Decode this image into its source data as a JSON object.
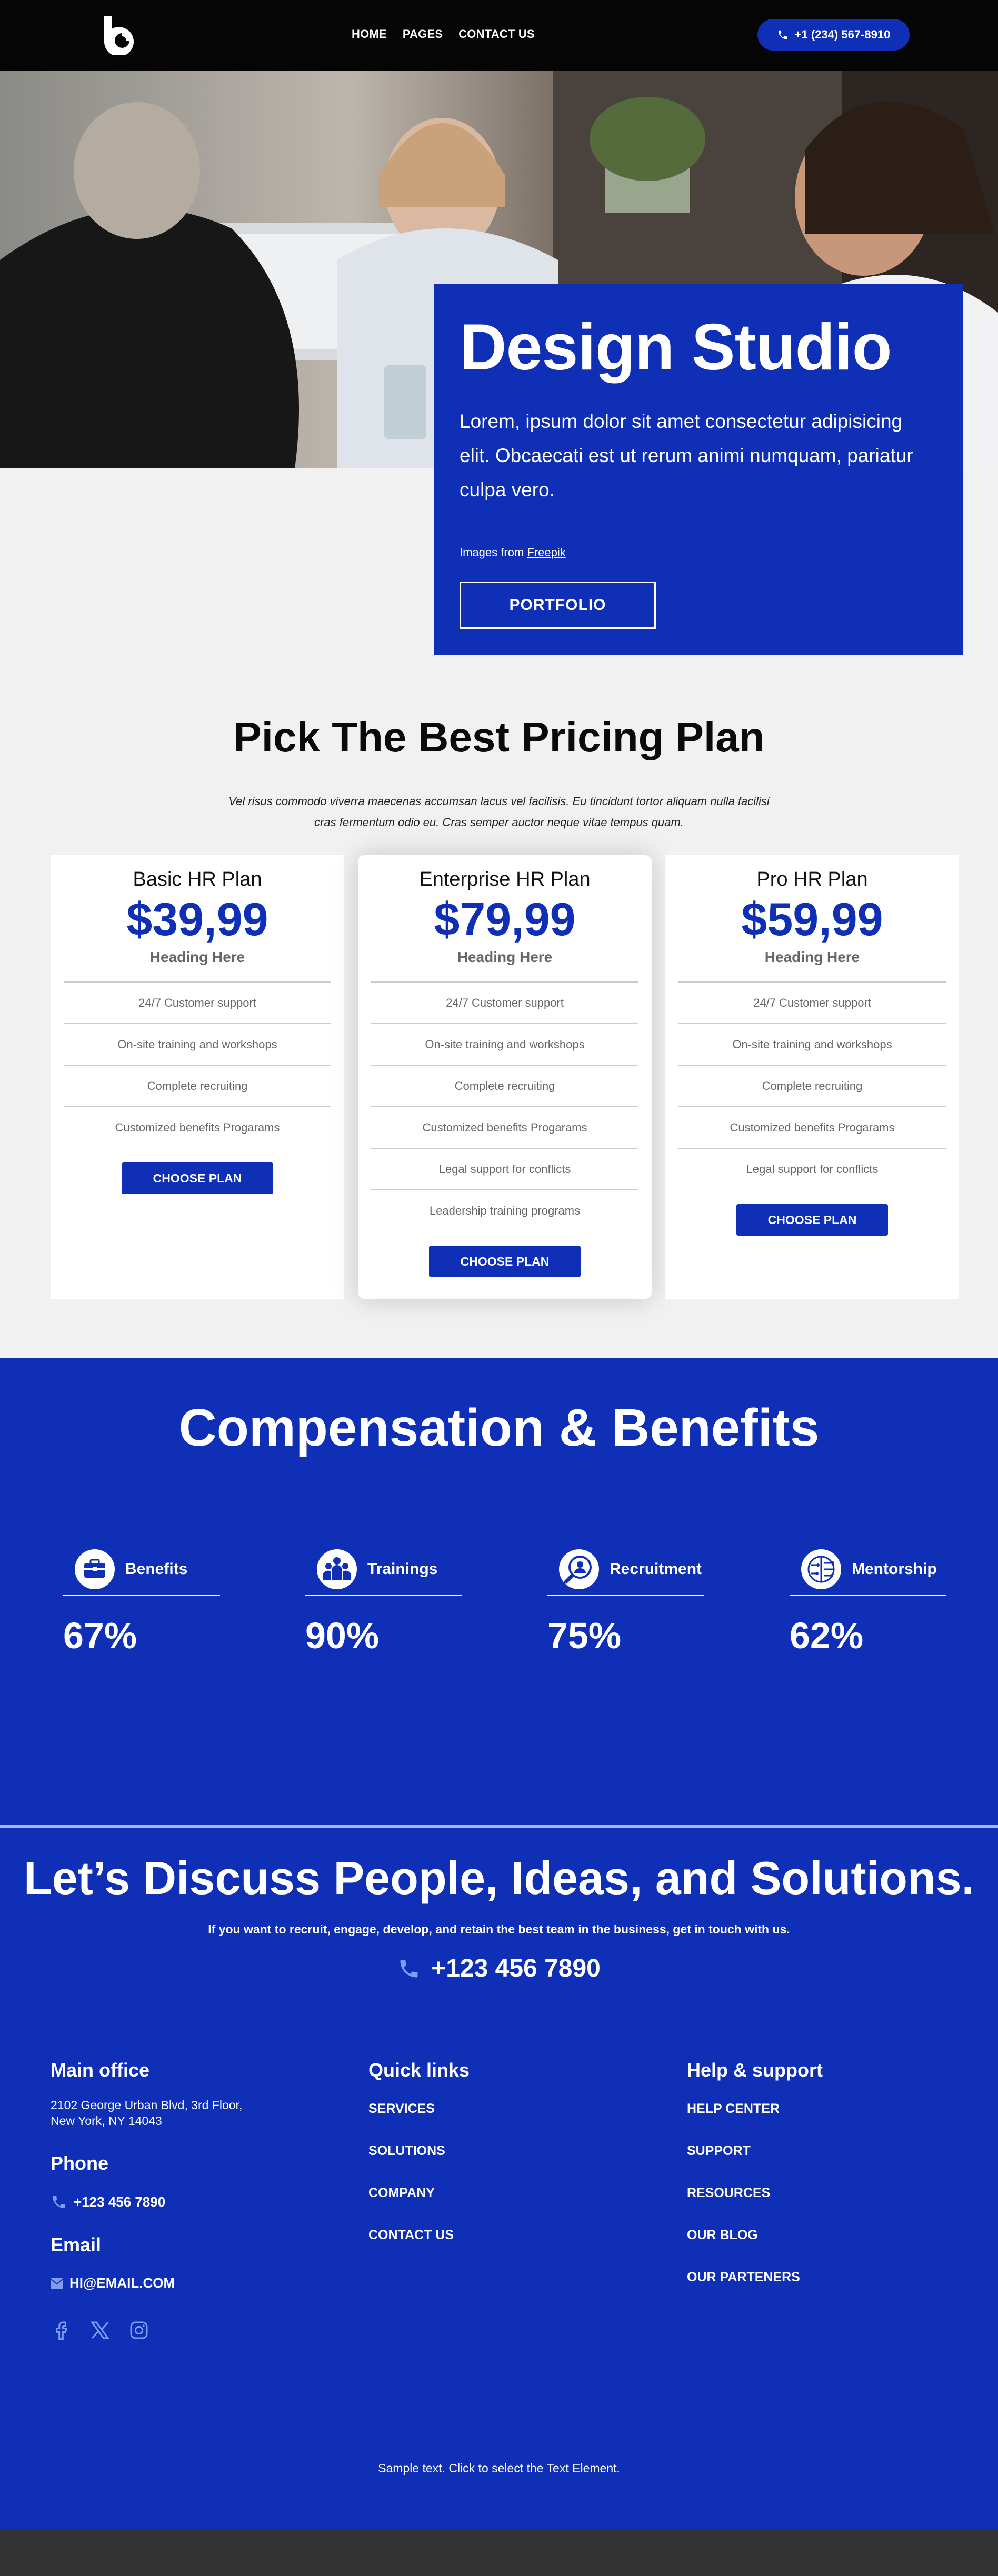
{
  "header": {
    "nav": [
      "HOME",
      "PAGES",
      "CONTACT US"
    ],
    "phone": "+1 (234) 567-8910"
  },
  "hero": {
    "title": "Design Studio",
    "text": "Lorem, ipsum dolor sit amet consectetur adipisicing elit. Obcaecati est ut rerum animi numquam, pariatur culpa vero.",
    "credit_prefix": "Images from ",
    "credit_link": "Freepik",
    "button": "PORTFOLIO"
  },
  "pricing": {
    "title": "Pick The Best Pricing Plan",
    "subtitle": "Vel risus commodo viverra maecenas accumsan lacus vel facilisis. Eu tincidunt tortor aliquam nulla facilisi cras fermentum odio eu. Cras semper auctor neque vitae tempus quam.",
    "plans": [
      {
        "name": "Basic HR Plan",
        "price": "$39,99",
        "heading": "Heading Here",
        "features": [
          "24/7 Customer support",
          "On-site training and workshops",
          "Complete recruiting",
          "Customized benefits Progarams"
        ],
        "button": "CHOOSE PLAN"
      },
      {
        "name": "Enterprise HR Plan",
        "price": "$79,99",
        "heading": "Heading Here",
        "features": [
          "24/7 Customer support",
          "On-site training and workshops",
          "Complete recruiting",
          "Customized benefits Progarams",
          "Legal support for conflicts",
          "Leadership training programs"
        ],
        "button": "CHOOSE PLAN"
      },
      {
        "name": "Pro HR Plan",
        "price": "$59,99",
        "heading": "Heading Here",
        "features": [
          "24/7 Customer support",
          "On-site training and workshops",
          "Complete recruiting",
          "Customized benefits Progarams",
          "Legal support for conflicts"
        ],
        "button": "CHOOSE PLAN"
      }
    ]
  },
  "benefits": {
    "title": "Compensation & Benefits",
    "stats": [
      {
        "label": "Benefits",
        "value": "67%",
        "icon": "briefcase-icon"
      },
      {
        "label": "Trainings",
        "value": "90%",
        "icon": "team-icon"
      },
      {
        "label": "Recruitment",
        "value": "75%",
        "icon": "user-search-icon"
      },
      {
        "label": "Mentorship",
        "value": "62%",
        "icon": "brain-circuit-icon"
      }
    ]
  },
  "cta": {
    "title": "Let’s Discuss People, Ideas, and Solutions.",
    "subtitle": "If you want to recruit, engage, develop, and retain the best team in the business, get in touch with us.",
    "phone": "+123 456 7890"
  },
  "footer": {
    "main_office": {
      "heading": "Main office",
      "address_line1": "2102 George Urban Blvd, 3rd Floor,",
      "address_line2": "New York, NY 14043",
      "phone_heading": "Phone",
      "phone": "+123 456 7890",
      "email_heading": "Email",
      "email": "HI@EMAIL.COM"
    },
    "quick_links": {
      "heading": "Quick links",
      "items": [
        "SERVICES",
        "SOLUTIONS",
        "COMPANY",
        "CONTACT US"
      ]
    },
    "help": {
      "heading": "Help & support",
      "items": [
        "HELP CENTER",
        "SUPPORT",
        "RESOURCES",
        "OUR BLOG",
        "OUR PARTENERS"
      ]
    },
    "sample_text": "Sample text. Click to select the Text Element."
  },
  "colors": {
    "brand_blue": "#0e2fb6",
    "header_bg": "#050505",
    "page_bg": "#f1f1f1",
    "footer_bar": "#333333"
  }
}
